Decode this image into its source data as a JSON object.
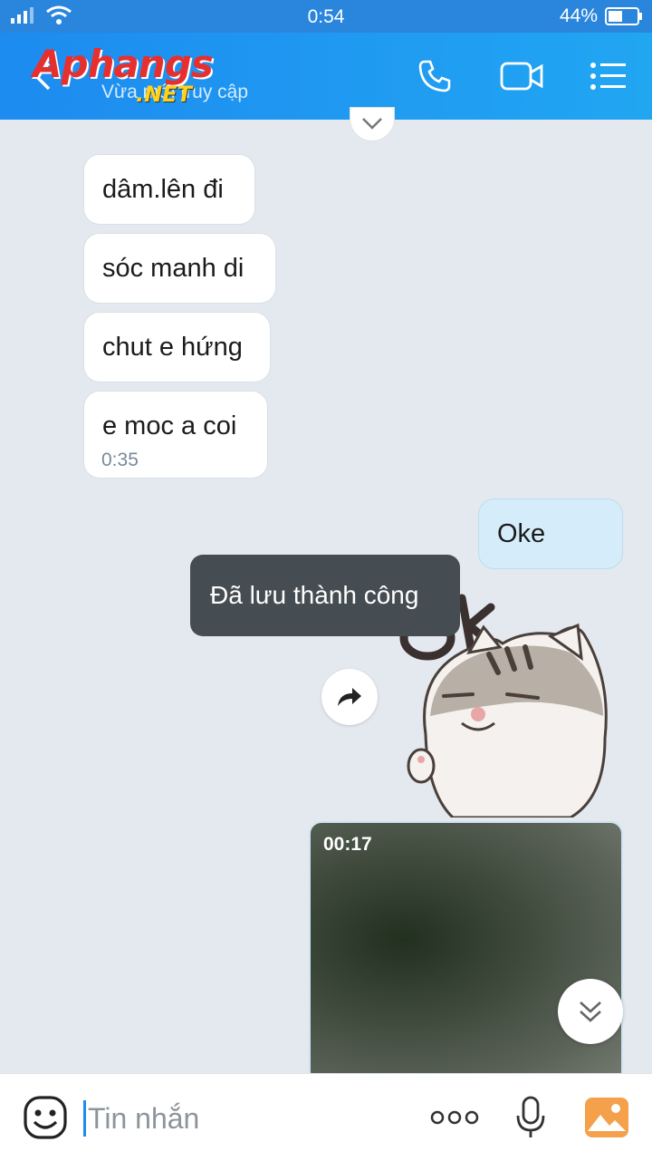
{
  "status_bar": {
    "time": "0:54",
    "battery": "44%"
  },
  "header": {
    "brand": "Aphangs",
    "brand_sub": ".NET",
    "subtitle": "Vừa mới truy cập"
  },
  "messages": {
    "incoming": [
      "dâm.lên đi",
      "sóc manh di",
      "chut e hứng",
      "e moc a coi"
    ],
    "incoming_time": "0:35",
    "outgoing": "Oke"
  },
  "toast": "Đã lưu thành công",
  "video": {
    "duration": "00:17"
  },
  "input": {
    "placeholder": "Tin nhắn"
  },
  "colors": {
    "header": "#1d8bf0",
    "outgoing_bubble": "#d5edfb",
    "toast": "#464d52",
    "background": "#e3e9ee"
  }
}
